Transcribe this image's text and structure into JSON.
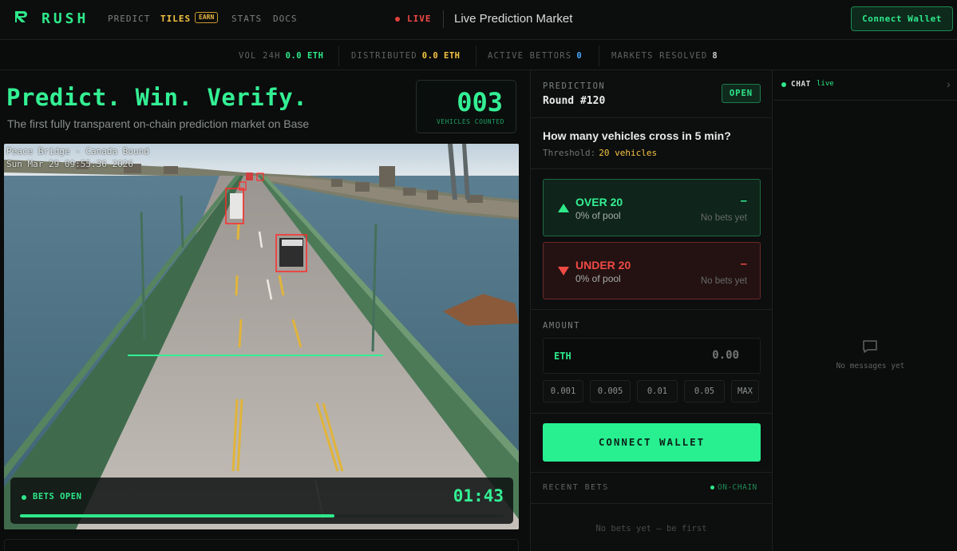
{
  "nav": {
    "brand": "RUSH",
    "links": [
      {
        "label": "PREDICT"
      },
      {
        "label": "TILES",
        "badge": "EARN"
      },
      {
        "label": "STATS"
      },
      {
        "label": "DOCS"
      }
    ],
    "live": "LIVE",
    "page_title": "Live Prediction Market",
    "connect": "Connect Wallet"
  },
  "stats": [
    {
      "label": "VOL 24H",
      "value": "0.0 ETH",
      "color": "#2ee88a"
    },
    {
      "label": "DISTRIBUTED",
      "value": "0.0 ETH",
      "color": "#f5c542"
    },
    {
      "label": "ACTIVE BETTORS",
      "value": "0",
      "color": "#4aa8ff"
    },
    {
      "label": "MARKETS RESOLVED",
      "value": "8",
      "color": "#c8ccca"
    }
  ],
  "hero": {
    "title": "Predict. Win. Verify.",
    "subtitle": "The first fully transparent on-chain prediction market on Base",
    "counter": "003",
    "counter_label": "VEHICLES COUNTED"
  },
  "camera": {
    "overlay_line1": "Peace Bridge - Canada Bound",
    "overlay_line2": "Sun Mar 29 09:55:36 2026",
    "bets_label": "BETS OPEN",
    "timer": "01:43",
    "progress": 0.65
  },
  "prediction": {
    "section_label": "PREDICTION",
    "round": "Round #120",
    "status": "OPEN",
    "question": "How many vehicles cross in 5 min?",
    "threshold_label": "Threshold:",
    "threshold_value": "20 vehicles",
    "over": {
      "title": "OVER 20",
      "pool": "0% of pool",
      "value": "–",
      "note": "No bets yet"
    },
    "under": {
      "title": "UNDER 20",
      "pool": "0% of pool",
      "value": "–",
      "note": "No bets yet"
    }
  },
  "amount": {
    "label": "AMOUNT",
    "currency": "ETH",
    "placeholder": "0.00",
    "presets": [
      "0.001",
      "0.005",
      "0.01",
      "0.05",
      "MAX"
    ]
  },
  "cta": {
    "connect": "CONNECT WALLET"
  },
  "recent": {
    "label": "RECENT BETS",
    "badge": "ON-CHAIN",
    "empty": "No bets yet — be first"
  },
  "chat": {
    "title": "CHAT",
    "status": "live",
    "empty": "No messages yet",
    "chevron": "›"
  },
  "icons": {
    "logo": "rush-logo-icon",
    "chat": "speech-bubble-icon"
  }
}
